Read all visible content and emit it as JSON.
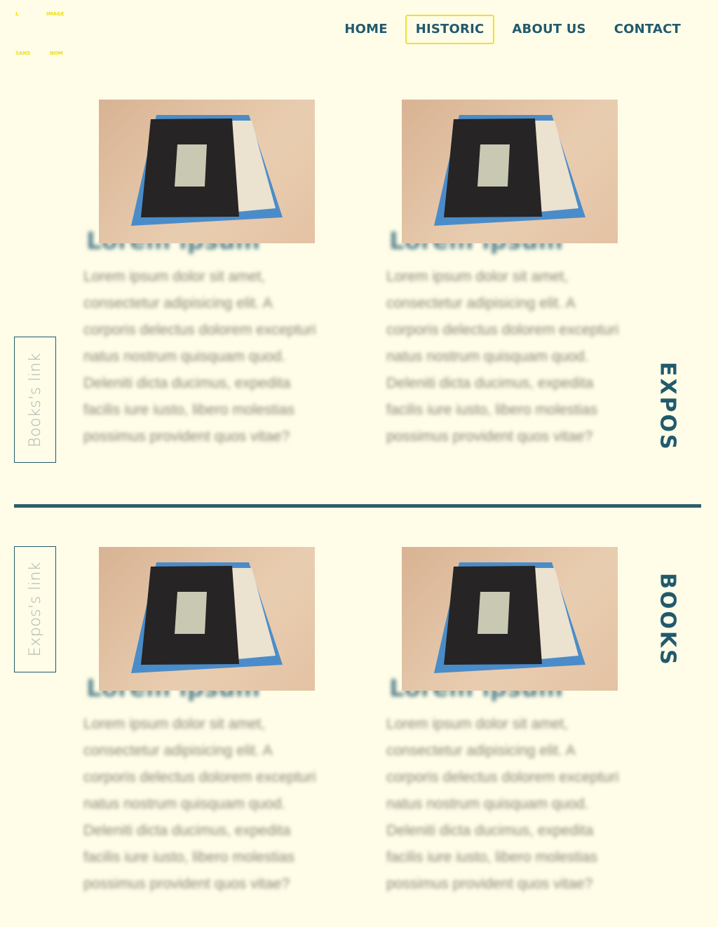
{
  "logo": {
    "words": [
      "L",
      "IMAGE",
      "SANS",
      "NOM"
    ]
  },
  "nav": {
    "items": [
      "Home",
      "Historic",
      "About us",
      "Contact"
    ],
    "active": "Historic"
  },
  "sections": [
    {
      "label": "Expos",
      "side_link": "Books's link",
      "cards": [
        {
          "title": "Lorem ipsum",
          "text": "Lorem ipsum dolor sit amet, consectetur adipisicing elit. A corporis delectus dolorem excepturi natus nostrum quisquam quod. Deleniti dicta ducimus, expedita facilis iure iusto, libero molestias possimus provident quos vitae?"
        },
        {
          "title": "Lorem ipsum",
          "text": "Lorem ipsum dolor sit amet, consectetur adipisicing elit. A corporis delectus dolorem excepturi natus nostrum quisquam quod. Deleniti dicta ducimus, expedita facilis iure iusto, libero molestias possimus provident quos vitae?"
        }
      ]
    },
    {
      "label": "Books",
      "side_link": "Expos's link",
      "cards": [
        {
          "title": "Lorem ipsum",
          "text": "Lorem ipsum dolor sit amet, consectetur adipisicing elit. A corporis delectus dolorem excepturi natus nostrum quisquam quod. Deleniti dicta ducimus, expedita facilis iure iusto, libero molestias possimus provident quos vitae?"
        },
        {
          "title": "Lorem ipsum",
          "text": "Lorem ipsum dolor sit amet, consectetur adipisicing elit. A corporis delectus dolorem excepturi natus nostrum quisquam quod. Deleniti dicta ducimus, expedita facilis iure iusto, libero molestias possimus provident quos vitae?"
        }
      ]
    }
  ],
  "colors": {
    "background": "#fffde8",
    "primary": "#215a6d",
    "accent": "#f2e02a",
    "muted_text": "#8a8578"
  }
}
